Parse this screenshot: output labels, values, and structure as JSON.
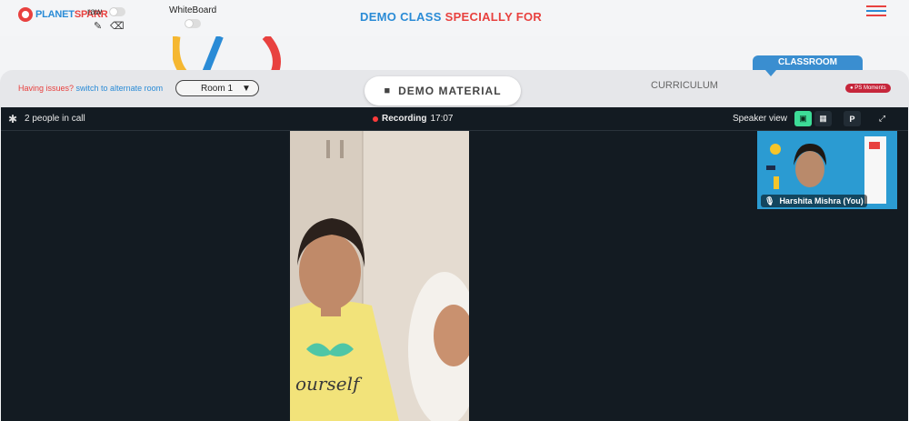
{
  "header": {
    "logo": {
      "part1": "PLANET",
      "part2": "SPARR"
    },
    "draw_label": "raw",
    "whiteboard_label": "WhiteBoard",
    "title_part1": "DEMO CLASS",
    "title_part2": "SPECIALLY FOR",
    "menu_icon": "hamburger-icon"
  },
  "toolbar": {
    "issues_text": "Having issues?",
    "alternate_link": "switch to alternate room",
    "room_select": "Room 1",
    "demo_material": "DEMO MATERIAL",
    "curriculum": "CURRICULUM",
    "classroom": "CLASSROOM",
    "ps_moments": "PS Moments"
  },
  "call": {
    "people_count": "2 people in call",
    "recording_label": "Recording",
    "recording_time": "17:07",
    "view_label": "Speaker view",
    "p_button": "P",
    "self_name": "Harshita Mishra (You)"
  },
  "colors": {
    "brand_blue": "#2a8bd6",
    "brand_red": "#e8413f",
    "call_bg": "#131b22",
    "active_view": "#3ddc97"
  }
}
